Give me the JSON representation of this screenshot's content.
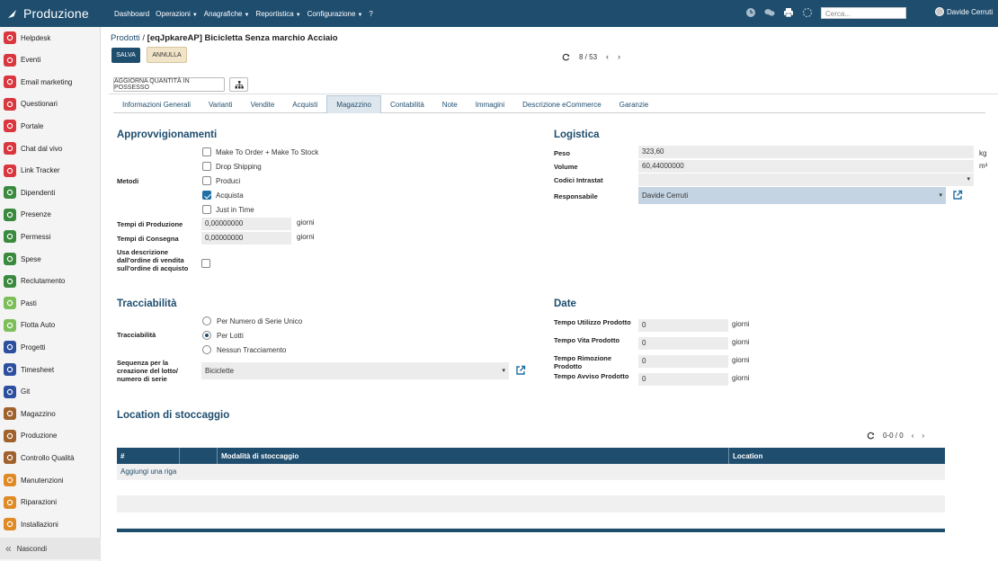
{
  "topbar": {
    "app_name": "Produzione",
    "menu": [
      "Dashboard",
      "Operazioni",
      "Anagrafiche",
      "Reportistica",
      "Configurazione",
      "?"
    ],
    "search_placeholder": "Cerca...",
    "user_name": "Davide Cerruti"
  },
  "sidebar": {
    "items": [
      {
        "label": "Helpdesk",
        "icon": "headset-icon",
        "color": "#d9363e"
      },
      {
        "label": "Eventi",
        "icon": "calendar-icon",
        "color": "#d9363e"
      },
      {
        "label": "Email marketing",
        "icon": "mail-icon",
        "color": "#d9363e"
      },
      {
        "label": "Questionari",
        "icon": "clipboard-icon",
        "color": "#d9363e"
      },
      {
        "label": "Portale",
        "icon": "portal-icon",
        "color": "#d9363e"
      },
      {
        "label": "Chat dal vivo",
        "icon": "chat-icon",
        "color": "#d9363e"
      },
      {
        "label": "Link Tracker",
        "icon": "link-icon",
        "color": "#d9363e"
      },
      {
        "label": "Dipendenti",
        "icon": "users-icon",
        "color": "#3a8a3e"
      },
      {
        "label": "Presenze",
        "icon": "presence-icon",
        "color": "#3a8a3e"
      },
      {
        "label": "Permessi",
        "icon": "permission-icon",
        "color": "#3a8a3e"
      },
      {
        "label": "Spese",
        "icon": "money-icon",
        "color": "#3a8a3e"
      },
      {
        "label": "Reclutamento",
        "icon": "recruit-icon",
        "color": "#3a8a3e"
      },
      {
        "label": "Pasti",
        "icon": "meal-icon",
        "color": "#7cbf5a"
      },
      {
        "label": "Flotta Auto",
        "icon": "car-icon",
        "color": "#7cbf5a"
      },
      {
        "label": "Progetti",
        "icon": "project-icon",
        "color": "#2c4f9e"
      },
      {
        "label": "Timesheet",
        "icon": "clock-icon",
        "color": "#2c4f9e"
      },
      {
        "label": "Git",
        "icon": "git-icon",
        "color": "#2c4f9e"
      },
      {
        "label": "Magazzino",
        "icon": "warehouse-icon",
        "color": "#a0622d"
      },
      {
        "label": "Produzione",
        "icon": "wrench-icon",
        "color": "#a0622d"
      },
      {
        "label": "Controllo Qualità",
        "icon": "quality-icon",
        "color": "#a0622d"
      },
      {
        "label": "Manutenzioni",
        "icon": "tools-icon",
        "color": "#e08a25"
      },
      {
        "label": "Riparazioni",
        "icon": "repair-icon",
        "color": "#e08a25"
      },
      {
        "label": "Installazioni",
        "icon": "install-icon",
        "color": "#e08a25"
      }
    ],
    "hide_label": "Nascondi"
  },
  "breadcrumb": {
    "parent": "Prodotti",
    "separator": "/",
    "current": "[eqJpkareAP] Bicicletta Senza marchio Acciaio"
  },
  "actions": {
    "save": "SALVA",
    "cancel": "ANNULLA"
  },
  "pager": {
    "text": "8 / 53"
  },
  "buttons": {
    "update_qty": "AGGIORNA QUANTITÀ IN POSSESSO"
  },
  "tabs": [
    "Informazioni Generali",
    "Varianti",
    "Vendite",
    "Acquisti",
    "Magazzino",
    "Contabilità",
    "Note",
    "Immagini",
    "Descrizione eCommerce",
    "Garanzie"
  ],
  "active_tab": "Magazzino",
  "approvvigionamenti": {
    "title": "Approvvigionamenti",
    "metodi_label": "Metodi",
    "metodi": [
      {
        "label": "Make To Order + Make To Stock",
        "checked": false
      },
      {
        "label": "Drop Shipping",
        "checked": false
      },
      {
        "label": "Produci",
        "checked": false
      },
      {
        "label": "Acquista",
        "checked": true
      },
      {
        "label": "Just in Time",
        "checked": false
      }
    ],
    "tempi_produzione_label": "Tempi di Produzione",
    "tempi_produzione_value": "0,00000000",
    "tempi_consegna_label": "Tempi di Consegna",
    "tempi_consegna_value": "0,00000000",
    "unit_giorni": "giorni",
    "usa_descrizione_label": "Usa descrizione dall'ordine di vendita sull'ordine di acquisto"
  },
  "logistica": {
    "title": "Logistica",
    "peso_label": "Peso",
    "peso_value": "323,60",
    "peso_unit": "kg",
    "volume_label": "Volume",
    "volume_value": "60,44000000",
    "volume_unit": "m³",
    "codici_label": "Codici Intrastat",
    "responsabile_label": "Responsabile",
    "responsabile_value": "Davide Cerruti"
  },
  "tracciabilita": {
    "title": "Tracciabilità",
    "label": "Tracciabilità",
    "options": [
      {
        "label": "Per Numero di Serie Unico",
        "selected": false
      },
      {
        "label": "Per Lotti",
        "selected": true
      },
      {
        "label": "Nessun Tracciamento",
        "selected": false
      }
    ],
    "sequenza_label": "Sequenza per la creazione del lotto/ numero di serie",
    "sequenza_value": "Biciclette"
  },
  "date": {
    "title": "Date",
    "rows": [
      {
        "label": "Tempo Utilizzo Prodotto",
        "value": "0",
        "unit": "giorni"
      },
      {
        "label": "Tempo Vita Prodotto",
        "value": "0",
        "unit": "giorni"
      },
      {
        "label": "Tempo Rimozione Prodotto",
        "value": "0",
        "unit": "giorni"
      },
      {
        "label": "Tempo Avviso Prodotto",
        "value": "0",
        "unit": "giorni"
      }
    ]
  },
  "location": {
    "title": "Location di stoccaggio",
    "pager": "0-0 / 0",
    "columns": [
      "#",
      "",
      "Modalità di stoccaggio",
      "Location"
    ],
    "add_row": "Aggiungi una riga"
  },
  "colors": {
    "primary": "#1f4d6e",
    "cancel_bg": "#f1e4c8"
  }
}
